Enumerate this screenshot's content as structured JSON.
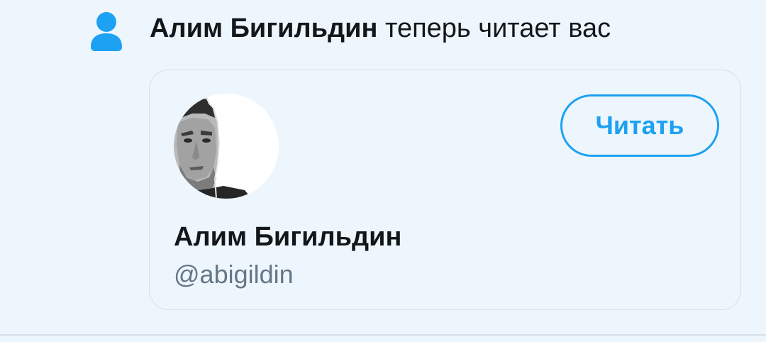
{
  "notification": {
    "icon": "person-icon",
    "actor_name": "Алим Бигильдин",
    "action_text": "теперь читает вас"
  },
  "user_card": {
    "avatar": "avatar-photo",
    "display_name": "Алим Бигильдин",
    "handle": "@abigildin",
    "follow_label": "Читать"
  },
  "colors": {
    "accent": "#1da1f2",
    "background": "#eef6fd",
    "text_primary": "#14171a",
    "text_secondary": "#657786",
    "border": "#d6dfe7"
  }
}
